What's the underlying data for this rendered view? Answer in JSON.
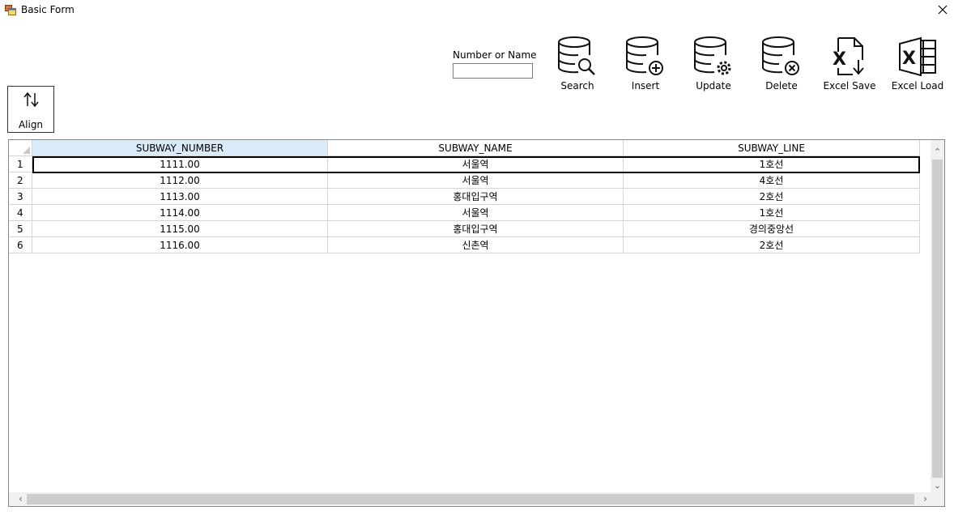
{
  "window": {
    "title": "Basic Form"
  },
  "search": {
    "label": "Number or Name",
    "value": "",
    "placeholder": ""
  },
  "toolbar": {
    "search_label": "Search",
    "insert_label": "Insert",
    "update_label": "Update",
    "delete_label": "Delete",
    "excel_save_label": "Excel Save",
    "excel_load_label": "Excel Load",
    "align_label": "Align"
  },
  "grid": {
    "columns": [
      "SUBWAY_NUMBER",
      "SUBWAY_NAME",
      "SUBWAY_LINE"
    ],
    "rows": [
      {
        "num": "1",
        "cells": [
          "1111.00",
          "서울역",
          "1호선"
        ]
      },
      {
        "num": "2",
        "cells": [
          "1112.00",
          "서울역",
          "4호선"
        ]
      },
      {
        "num": "3",
        "cells": [
          "1113.00",
          "홍대입구역",
          "2호선"
        ]
      },
      {
        "num": "4",
        "cells": [
          "1114.00",
          "서울역",
          "1호선"
        ]
      },
      {
        "num": "5",
        "cells": [
          "1115.00",
          "홍대입구역",
          "경의중앙선"
        ]
      },
      {
        "num": "6",
        "cells": [
          "1116.00",
          "신촌역",
          "2호선"
        ]
      }
    ],
    "selected_row": 1
  },
  "icons": {
    "search": "database-search-icon",
    "insert": "database-add-icon",
    "update": "database-settings-icon",
    "delete": "database-delete-icon",
    "excel_save": "excel-export-icon",
    "excel_load": "excel-import-icon",
    "align": "sort-arrows-icon"
  },
  "colors": {
    "header_selected": "#d9ebf9",
    "grid_line": "#d5d5d5",
    "scroll_track": "#f0f0f0"
  }
}
